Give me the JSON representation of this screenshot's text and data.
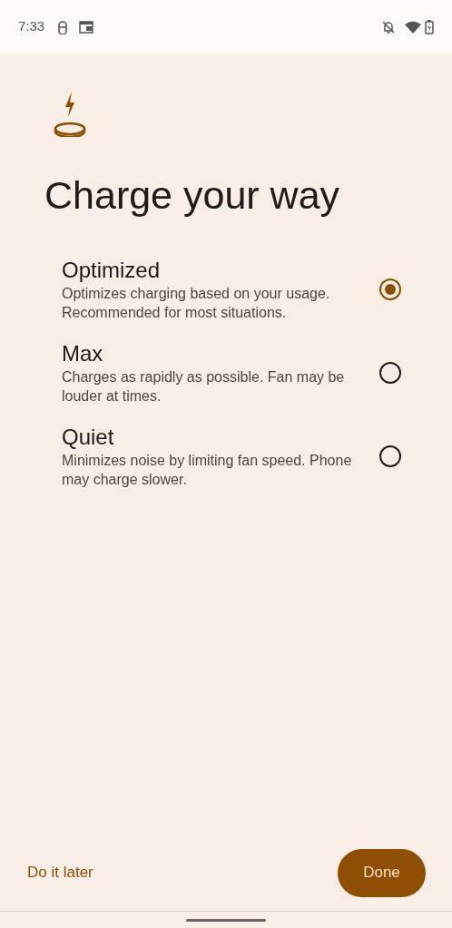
{
  "status_bar": {
    "time": "7:33"
  },
  "title": "Charge your way",
  "options": [
    {
      "title": "Optimized",
      "description": "Optimizes charging based on your usage. Recommended for most situations.",
      "selected": true
    },
    {
      "title": "Max",
      "description": "Charges as rapidly as possible. Fan may be louder at times.",
      "selected": false
    },
    {
      "title": "Quiet",
      "description": "Minimizes noise by limiting fan speed. Phone may charge slower.",
      "selected": false
    }
  ],
  "buttons": {
    "secondary": "Do it later",
    "primary": "Done"
  }
}
